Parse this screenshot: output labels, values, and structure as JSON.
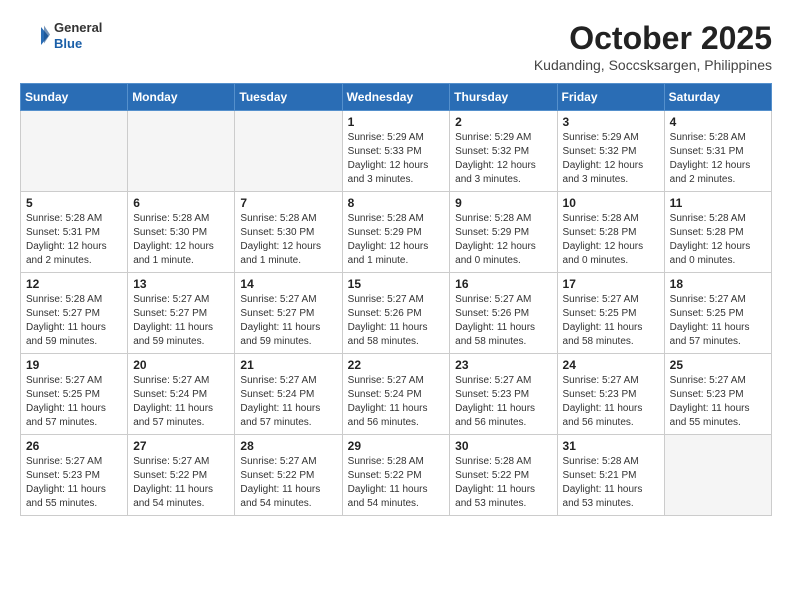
{
  "header": {
    "logo": {
      "general": "General",
      "blue": "Blue"
    },
    "title": "October 2025",
    "location": "Kudanding, Soccsksargen, Philippines"
  },
  "weekdays": [
    "Sunday",
    "Monday",
    "Tuesday",
    "Wednesday",
    "Thursday",
    "Friday",
    "Saturday"
  ],
  "weeks": [
    [
      {
        "day": "",
        "info": ""
      },
      {
        "day": "",
        "info": ""
      },
      {
        "day": "",
        "info": ""
      },
      {
        "day": "1",
        "info": "Sunrise: 5:29 AM\nSunset: 5:33 PM\nDaylight: 12 hours\nand 3 minutes."
      },
      {
        "day": "2",
        "info": "Sunrise: 5:29 AM\nSunset: 5:32 PM\nDaylight: 12 hours\nand 3 minutes."
      },
      {
        "day": "3",
        "info": "Sunrise: 5:29 AM\nSunset: 5:32 PM\nDaylight: 12 hours\nand 3 minutes."
      },
      {
        "day": "4",
        "info": "Sunrise: 5:28 AM\nSunset: 5:31 PM\nDaylight: 12 hours\nand 2 minutes."
      }
    ],
    [
      {
        "day": "5",
        "info": "Sunrise: 5:28 AM\nSunset: 5:31 PM\nDaylight: 12 hours\nand 2 minutes."
      },
      {
        "day": "6",
        "info": "Sunrise: 5:28 AM\nSunset: 5:30 PM\nDaylight: 12 hours\nand 1 minute."
      },
      {
        "day": "7",
        "info": "Sunrise: 5:28 AM\nSunset: 5:30 PM\nDaylight: 12 hours\nand 1 minute."
      },
      {
        "day": "8",
        "info": "Sunrise: 5:28 AM\nSunset: 5:29 PM\nDaylight: 12 hours\nand 1 minute."
      },
      {
        "day": "9",
        "info": "Sunrise: 5:28 AM\nSunset: 5:29 PM\nDaylight: 12 hours\nand 0 minutes."
      },
      {
        "day": "10",
        "info": "Sunrise: 5:28 AM\nSunset: 5:28 PM\nDaylight: 12 hours\nand 0 minutes."
      },
      {
        "day": "11",
        "info": "Sunrise: 5:28 AM\nSunset: 5:28 PM\nDaylight: 12 hours\nand 0 minutes."
      }
    ],
    [
      {
        "day": "12",
        "info": "Sunrise: 5:28 AM\nSunset: 5:27 PM\nDaylight: 11 hours\nand 59 minutes."
      },
      {
        "day": "13",
        "info": "Sunrise: 5:27 AM\nSunset: 5:27 PM\nDaylight: 11 hours\nand 59 minutes."
      },
      {
        "day": "14",
        "info": "Sunrise: 5:27 AM\nSunset: 5:27 PM\nDaylight: 11 hours\nand 59 minutes."
      },
      {
        "day": "15",
        "info": "Sunrise: 5:27 AM\nSunset: 5:26 PM\nDaylight: 11 hours\nand 58 minutes."
      },
      {
        "day": "16",
        "info": "Sunrise: 5:27 AM\nSunset: 5:26 PM\nDaylight: 11 hours\nand 58 minutes."
      },
      {
        "day": "17",
        "info": "Sunrise: 5:27 AM\nSunset: 5:25 PM\nDaylight: 11 hours\nand 58 minutes."
      },
      {
        "day": "18",
        "info": "Sunrise: 5:27 AM\nSunset: 5:25 PM\nDaylight: 11 hours\nand 57 minutes."
      }
    ],
    [
      {
        "day": "19",
        "info": "Sunrise: 5:27 AM\nSunset: 5:25 PM\nDaylight: 11 hours\nand 57 minutes."
      },
      {
        "day": "20",
        "info": "Sunrise: 5:27 AM\nSunset: 5:24 PM\nDaylight: 11 hours\nand 57 minutes."
      },
      {
        "day": "21",
        "info": "Sunrise: 5:27 AM\nSunset: 5:24 PM\nDaylight: 11 hours\nand 57 minutes."
      },
      {
        "day": "22",
        "info": "Sunrise: 5:27 AM\nSunset: 5:24 PM\nDaylight: 11 hours\nand 56 minutes."
      },
      {
        "day": "23",
        "info": "Sunrise: 5:27 AM\nSunset: 5:23 PM\nDaylight: 11 hours\nand 56 minutes."
      },
      {
        "day": "24",
        "info": "Sunrise: 5:27 AM\nSunset: 5:23 PM\nDaylight: 11 hours\nand 56 minutes."
      },
      {
        "day": "25",
        "info": "Sunrise: 5:27 AM\nSunset: 5:23 PM\nDaylight: 11 hours\nand 55 minutes."
      }
    ],
    [
      {
        "day": "26",
        "info": "Sunrise: 5:27 AM\nSunset: 5:23 PM\nDaylight: 11 hours\nand 55 minutes."
      },
      {
        "day": "27",
        "info": "Sunrise: 5:27 AM\nSunset: 5:22 PM\nDaylight: 11 hours\nand 54 minutes."
      },
      {
        "day": "28",
        "info": "Sunrise: 5:27 AM\nSunset: 5:22 PM\nDaylight: 11 hours\nand 54 minutes."
      },
      {
        "day": "29",
        "info": "Sunrise: 5:28 AM\nSunset: 5:22 PM\nDaylight: 11 hours\nand 54 minutes."
      },
      {
        "day": "30",
        "info": "Sunrise: 5:28 AM\nSunset: 5:22 PM\nDaylight: 11 hours\nand 53 minutes."
      },
      {
        "day": "31",
        "info": "Sunrise: 5:28 AM\nSunset: 5:21 PM\nDaylight: 11 hours\nand 53 minutes."
      },
      {
        "day": "",
        "info": ""
      }
    ]
  ]
}
